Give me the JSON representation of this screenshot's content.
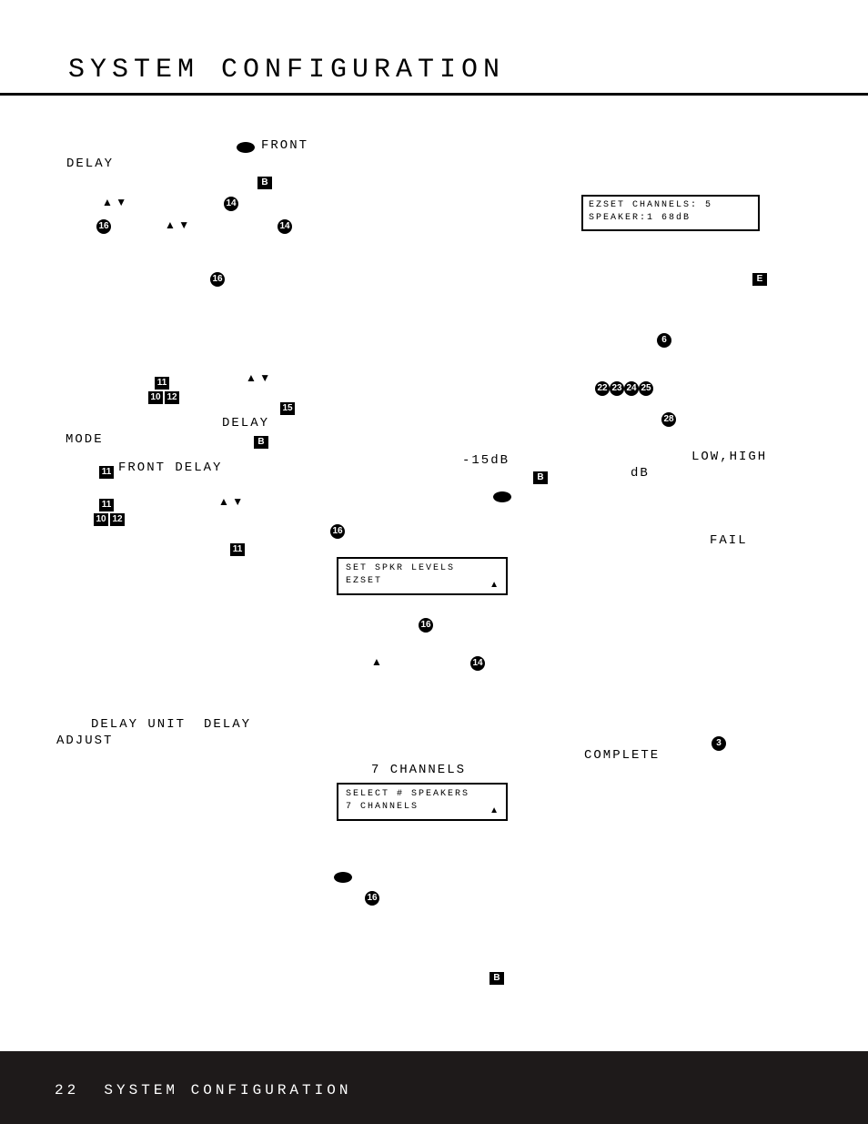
{
  "page_title": "SYSTEM CONFIGURATION",
  "labels": {
    "front": "FRONT",
    "delay1": "DELAY",
    "mode": "MODE",
    "front_delay": "FRONT DELAY",
    "delay2": "DELAY",
    "delay_unit": "DELAY UNIT",
    "delay3": "DELAY",
    "adjust": "ADJUST",
    "seven_channels": "7 CHANNELS",
    "minus15": "-15dB",
    "db": "dB",
    "low_high": "LOW,HIGH",
    "fail": "FAIL",
    "complete": "COMPLETE"
  },
  "arrows": "▲ ▼",
  "up": "▲",
  "circles": {
    "c14": "14",
    "c16": "16",
    "c15": "15",
    "c6": "6",
    "c22": "22",
    "c23": "23",
    "c24": "24",
    "c25": "25",
    "c28": "28",
    "c3": "3"
  },
  "squares": {
    "sB": "B",
    "sE": "E",
    "s11": "11",
    "s10": "10",
    "s12": "12"
  },
  "box1": {
    "line1": "SET SPKR LEVELS",
    "line2": "EZSET"
  },
  "box2": {
    "line1": "SELECT # SPEAKERS",
    "line2": "7 CHANNELS"
  },
  "box3": {
    "line1": "EZSET CHANNELS: 5",
    "line2": "SPEAKER:1  68dB"
  },
  "footer": {
    "page_number": "22",
    "section": "SYSTEM CONFIGURATION"
  }
}
